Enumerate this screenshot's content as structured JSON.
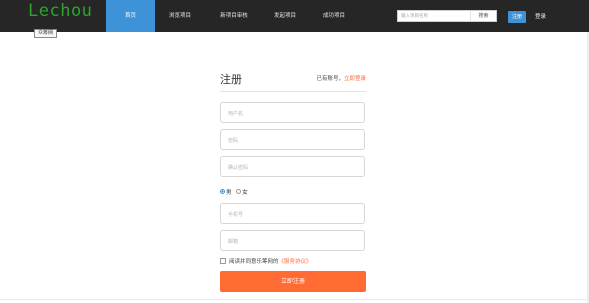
{
  "header": {
    "brand": "Lechou",
    "brand_tag": "众筹网",
    "nav": [
      {
        "label": "首页",
        "active": true
      },
      {
        "label": "浏览项目",
        "active": false
      },
      {
        "label": "新项目审核",
        "active": false
      },
      {
        "label": "发起项目",
        "active": false
      },
      {
        "label": "成功项目",
        "active": false
      }
    ],
    "search": {
      "placeholder": "输入项目名称",
      "button": "搜索"
    },
    "register_button": "注册",
    "login_link": "登录"
  },
  "form": {
    "title": "注册",
    "have_account": "已有账号，",
    "login_now": "立即登录",
    "fields": {
      "username": "用户名",
      "password": "密码",
      "confirm_password": "确认密码",
      "phone": "手机号",
      "email": "邮箱"
    },
    "gender": {
      "male": "男",
      "female": "女",
      "selected": "男"
    },
    "agree_text": "阅读并同意乐筹网的",
    "agreement_link": "《服务协议》",
    "submit": "立即注册"
  },
  "colors": {
    "header_bg": "#262626",
    "nav_active": "#3e92d8",
    "brand": "#2aa52a",
    "accent": "#ff6b33"
  }
}
